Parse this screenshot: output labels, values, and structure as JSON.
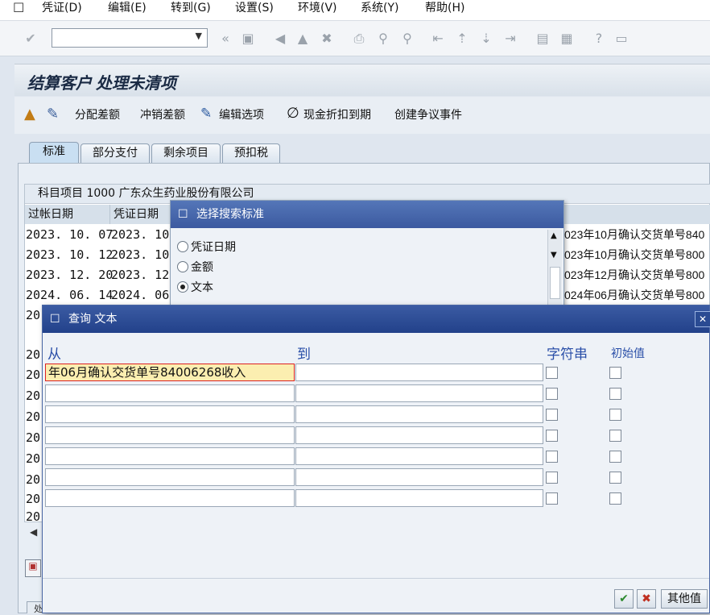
{
  "menu": {
    "items": [
      "凭证(D)",
      "编辑(E)",
      "转到(G)",
      "设置(S)",
      "环境(V)",
      "系统(Y)",
      "帮助(H)"
    ]
  },
  "toolbar": {
    "command_value": ""
  },
  "screen": {
    "title": "结算客户 处理未清项"
  },
  "app_toolbar": {
    "distribute_diff": "分配差额",
    "writeoff_diff": "冲销差额",
    "edit_options": "编辑选项",
    "cash_discount": "现金折扣到期",
    "create_dispute": "创建争议事件"
  },
  "tabs": [
    "标准",
    "部分支付",
    "剩余项目",
    "预扣税"
  ],
  "grid": {
    "header": "科目项目 1000 广东众生药业股份有限公司",
    "columns": [
      "过帐日期",
      "凭证日期"
    ],
    "rows": [
      {
        "post": "2023. 10. 07",
        "doc": "2023. 10.",
        "text": "023年10月确认交货单号840"
      },
      {
        "post": "2023. 10. 12",
        "doc": "2023. 10.",
        "text": "023年10月确认交货单号800"
      },
      {
        "post": "2023. 12. 20",
        "doc": "2023. 12.",
        "text": "023年12月确认交货单号800"
      },
      {
        "post": "2024. 06. 14",
        "doc": "2024. 06.",
        "text": "024年06月确认交货单号800"
      }
    ],
    "partial_rows": [
      "20",
      "20",
      "20",
      "20",
      "20",
      "20",
      "20",
      "20",
      "20",
      "20"
    ]
  },
  "search_popup": {
    "title": "选择搜索标准",
    "options": [
      "凭证日期",
      "金额",
      "文本"
    ],
    "selected": "文本"
  },
  "query_dialog": {
    "title": "查询 文本",
    "label_from": "从",
    "label_to": "到",
    "label_string": "字符串",
    "label_initial": "初始值",
    "first_from_value": "年06月确认交货单号84006268收入",
    "other_values_button": "其他值"
  },
  "colors": {
    "dialog_title_bg": "#2d4c95",
    "label_blue": "#2a4fa8",
    "highlight_field": "#fbeeb0"
  }
}
